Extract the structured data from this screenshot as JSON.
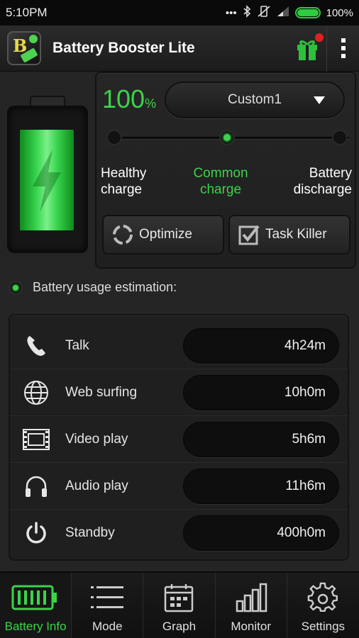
{
  "status_bar": {
    "time": "5:10PM",
    "battery_percent": "100%",
    "icons": [
      "more-dots-icon",
      "bluetooth-icon",
      "vibrate-off-icon",
      "signal-icon",
      "battery-icon"
    ]
  },
  "app_bar": {
    "title": "Battery Booster Lite",
    "icons": [
      "app-logo",
      "gift-icon",
      "overflow-menu-icon"
    ]
  },
  "battery": {
    "level_value": "100",
    "level_unit": "%",
    "fill_fraction": 1.0
  },
  "mode_select": {
    "value": "Custom1"
  },
  "charge_levels": [
    {
      "line1": "Healthy",
      "line2": "charge",
      "active": false
    },
    {
      "line1": "Common",
      "line2": "charge",
      "active": true
    },
    {
      "line1": "Battery",
      "line2": "discharge",
      "active": false
    }
  ],
  "buttons": {
    "optimize": "Optimize",
    "task_killer": "Task Killer"
  },
  "usage": {
    "title": "Battery usage estimation:",
    "rows": [
      {
        "label": "Talk",
        "value": "4h24m",
        "icon": "phone-icon"
      },
      {
        "label": "Web surfing",
        "value": "10h0m",
        "icon": "globe-icon"
      },
      {
        "label": "Video play",
        "value": "5h6m",
        "icon": "film-icon"
      },
      {
        "label": "Audio play",
        "value": "11h6m",
        "icon": "headphones-icon"
      },
      {
        "label": "Standby",
        "value": "400h0m",
        "icon": "power-icon"
      }
    ]
  },
  "bottom_nav": [
    {
      "label": "Battery Info",
      "icon": "battery-info-icon",
      "active": true
    },
    {
      "label": "Mode",
      "icon": "list-icon",
      "active": false
    },
    {
      "label": "Graph",
      "icon": "calendar-icon",
      "active": false
    },
    {
      "label": "Monitor",
      "icon": "bar-chart-icon",
      "active": false
    },
    {
      "label": "Settings",
      "icon": "gear-icon",
      "active": false
    }
  ],
  "colors": {
    "accent": "#3ad44a",
    "background": "#232323",
    "badge": "#e02020"
  }
}
